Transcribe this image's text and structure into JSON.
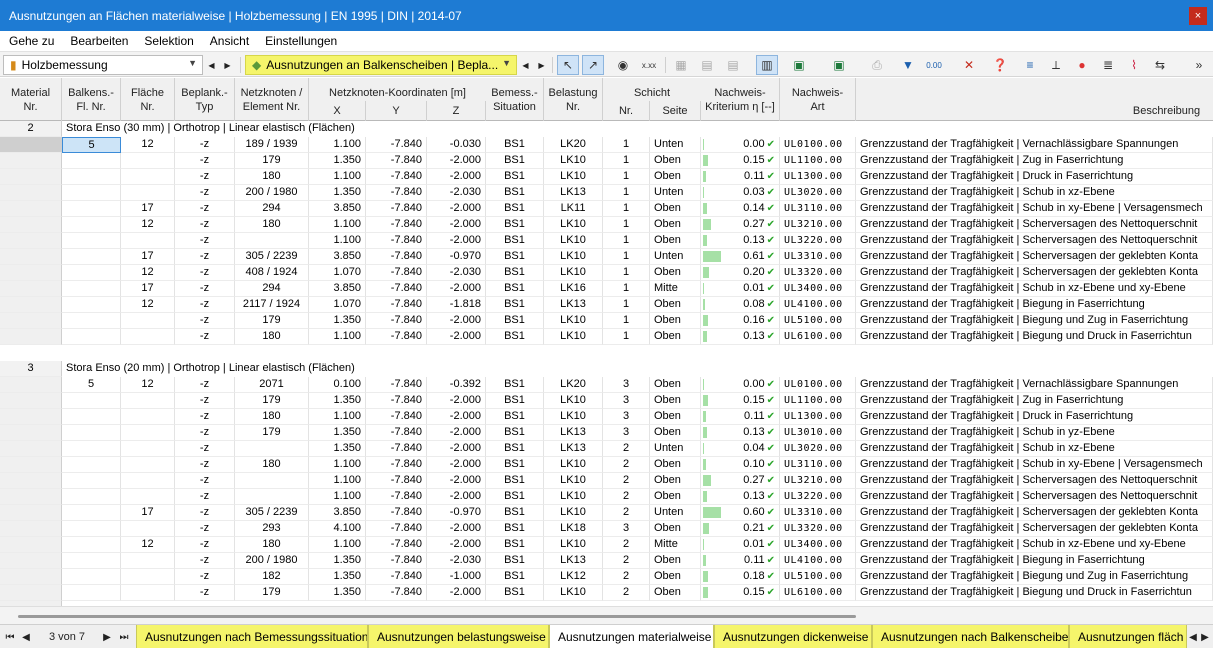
{
  "window": {
    "title": "Ausnutzungen an Flächen materialweise | Holzbemessung | EN 1995 | DIN | 2014-07",
    "close_glyph": "×"
  },
  "menu": [
    "Gehe zu",
    "Bearbeiten",
    "Selektion",
    "Ansicht",
    "Einstellungen"
  ],
  "toolbar": {
    "module_combo": "Holzbemessung",
    "result_combo": "Ausnutzungen an Balkenscheiben | Bepla..."
  },
  "columns": {
    "material": "Material\nNr.",
    "balken": "Balkens.-\nFl. Nr.",
    "flaeche": "Fläche\nNr.",
    "beplank": "Beplank.-\nTyp",
    "netz": "Netzknoten /\nElement Nr.",
    "koord_group": "Netzknoten-Koordinaten [m]",
    "x": "X",
    "y": "Y",
    "z": "Z",
    "bemess": "Bemess.-\nSituation",
    "belastung": "Belastung\nNr.",
    "schicht_group": "Schicht",
    "schicht_nr": "Nr.",
    "seite": "Seite",
    "kriterium": "Nachweis-\nKriterium η [--]",
    "art": "Nachweis-\nArt",
    "beschreibung": "Beschreibung"
  },
  "groups": [
    {
      "material": "2",
      "title": "Stora Enso (30 mm) | Orthotrop | Linear elastisch (Flächen)",
      "rows": [
        [
          "5",
          "12",
          "-z",
          "189 / 1939",
          "1.100",
          "-7.840",
          "-0.030",
          "BS1",
          "LK20",
          "1",
          "Unten",
          "0.00",
          "UL0100.00",
          "Grenzzustand der Tragfähigkeit | Vernachlässigbare Spannungen"
        ],
        [
          "",
          "",
          "-z",
          "179",
          "1.350",
          "-7.840",
          "-2.000",
          "BS1",
          "LK10",
          "1",
          "Oben",
          "0.15",
          "UL1100.00",
          "Grenzzustand der Tragfähigkeit | Zug in Faserrichtung"
        ],
        [
          "",
          "",
          "-z",
          "180",
          "1.100",
          "-7.840",
          "-2.000",
          "BS1",
          "LK10",
          "1",
          "Oben",
          "0.11",
          "UL1300.00",
          "Grenzzustand der Tragfähigkeit | Druck in Faserrichtung"
        ],
        [
          "",
          "",
          "-z",
          "200 / 1980",
          "1.350",
          "-7.840",
          "-2.030",
          "BS1",
          "LK13",
          "1",
          "Unten",
          "0.03",
          "UL3020.00",
          "Grenzzustand der Tragfähigkeit | Schub in xz-Ebene"
        ],
        [
          "",
          "17",
          "-z",
          "294",
          "3.850",
          "-7.840",
          "-2.000",
          "BS1",
          "LK11",
          "1",
          "Oben",
          "0.14",
          "UL3110.00",
          "Grenzzustand der Tragfähigkeit | Schub in xy-Ebene | Versagensmech"
        ],
        [
          "",
          "12",
          "-z",
          "180",
          "1.100",
          "-7.840",
          "-2.000",
          "BS1",
          "LK10",
          "1",
          "Oben",
          "0.27",
          "UL3210.00",
          "Grenzzustand der Tragfähigkeit | Scherversagen des Nettoquerschnit"
        ],
        [
          "",
          "",
          "-z",
          "",
          "1.100",
          "-7.840",
          "-2.000",
          "BS1",
          "LK10",
          "1",
          "Oben",
          "0.13",
          "UL3220.00",
          "Grenzzustand der Tragfähigkeit | Scherversagen des Nettoquerschnit"
        ],
        [
          "",
          "17",
          "-z",
          "305 / 2239",
          "3.850",
          "-7.840",
          "-0.970",
          "BS1",
          "LK10",
          "1",
          "Unten",
          "0.61",
          "UL3310.00",
          "Grenzzustand der Tragfähigkeit | Scherversagen der geklebten Konta"
        ],
        [
          "",
          "12",
          "-z",
          "408 / 1924",
          "1.070",
          "-7.840",
          "-2.030",
          "BS1",
          "LK10",
          "1",
          "Oben",
          "0.20",
          "UL3320.00",
          "Grenzzustand der Tragfähigkeit | Scherversagen der geklebten Konta"
        ],
        [
          "",
          "17",
          "-z",
          "294",
          "3.850",
          "-7.840",
          "-2.000",
          "BS1",
          "LK16",
          "1",
          "Mitte",
          "0.01",
          "UL3400.00",
          "Grenzzustand der Tragfähigkeit | Schub in xz-Ebene und xy-Ebene"
        ],
        [
          "",
          "12",
          "-z",
          "2117 / 1924",
          "1.070",
          "-7.840",
          "-1.818",
          "BS1",
          "LK13",
          "1",
          "Oben",
          "0.08",
          "UL4100.00",
          "Grenzzustand der Tragfähigkeit | Biegung in Faserrichtung"
        ],
        [
          "",
          "",
          "-z",
          "179",
          "1.350",
          "-7.840",
          "-2.000",
          "BS1",
          "LK10",
          "1",
          "Oben",
          "0.16",
          "UL5100.00",
          "Grenzzustand der Tragfähigkeit | Biegung und Zug in Faserrichtung"
        ],
        [
          "",
          "",
          "-z",
          "180",
          "1.100",
          "-7.840",
          "-2.000",
          "BS1",
          "LK10",
          "1",
          "Oben",
          "0.13",
          "UL6100.00",
          "Grenzzustand der Tragfähigkeit | Biegung und Druck in Faserrichtun"
        ]
      ]
    },
    {
      "material": "3",
      "title": "Stora Enso (20 mm) | Orthotrop | Linear elastisch (Flächen)",
      "rows": [
        [
          "5",
          "12",
          "-z",
          "2071",
          "0.100",
          "-7.840",
          "-0.392",
          "BS1",
          "LK20",
          "3",
          "Oben",
          "0.00",
          "UL0100.00",
          "Grenzzustand der Tragfähigkeit | Vernachlässigbare Spannungen"
        ],
        [
          "",
          "",
          "-z",
          "179",
          "1.350",
          "-7.840",
          "-2.000",
          "BS1",
          "LK10",
          "3",
          "Oben",
          "0.15",
          "UL1100.00",
          "Grenzzustand der Tragfähigkeit | Zug in Faserrichtung"
        ],
        [
          "",
          "",
          "-z",
          "180",
          "1.100",
          "-7.840",
          "-2.000",
          "BS1",
          "LK10",
          "3",
          "Oben",
          "0.11",
          "UL1300.00",
          "Grenzzustand der Tragfähigkeit | Druck in Faserrichtung"
        ],
        [
          "",
          "",
          "-z",
          "179",
          "1.350",
          "-7.840",
          "-2.000",
          "BS1",
          "LK13",
          "3",
          "Oben",
          "0.13",
          "UL3010.00",
          "Grenzzustand der Tragfähigkeit | Schub in yz-Ebene"
        ],
        [
          "",
          "",
          "-z",
          "",
          "1.350",
          "-7.840",
          "-2.000",
          "BS1",
          "LK13",
          "2",
          "Unten",
          "0.04",
          "UL3020.00",
          "Grenzzustand der Tragfähigkeit | Schub in xz-Ebene"
        ],
        [
          "",
          "",
          "-z",
          "180",
          "1.100",
          "-7.840",
          "-2.000",
          "BS1",
          "LK10",
          "2",
          "Oben",
          "0.10",
          "UL3110.00",
          "Grenzzustand der Tragfähigkeit | Schub in xy-Ebene | Versagensmech"
        ],
        [
          "",
          "",
          "-z",
          "",
          "1.100",
          "-7.840",
          "-2.000",
          "BS1",
          "LK10",
          "2",
          "Oben",
          "0.27",
          "UL3210.00",
          "Grenzzustand der Tragfähigkeit | Scherversagen des Nettoquerschnit"
        ],
        [
          "",
          "",
          "-z",
          "",
          "1.100",
          "-7.840",
          "-2.000",
          "BS1",
          "LK10",
          "2",
          "Oben",
          "0.13",
          "UL3220.00",
          "Grenzzustand der Tragfähigkeit | Scherversagen des Nettoquerschnit"
        ],
        [
          "",
          "17",
          "-z",
          "305 / 2239",
          "3.850",
          "-7.840",
          "-0.970",
          "BS1",
          "LK10",
          "2",
          "Unten",
          "0.60",
          "UL3310.00",
          "Grenzzustand der Tragfähigkeit | Scherversagen der geklebten Konta"
        ],
        [
          "",
          "",
          "-z",
          "293",
          "4.100",
          "-7.840",
          "-2.000",
          "BS1",
          "LK18",
          "3",
          "Oben",
          "0.21",
          "UL3320.00",
          "Grenzzustand der Tragfähigkeit | Scherversagen der geklebten Konta"
        ],
        [
          "",
          "12",
          "-z",
          "180",
          "1.100",
          "-7.840",
          "-2.000",
          "BS1",
          "LK10",
          "2",
          "Mitte",
          "0.01",
          "UL3400.00",
          "Grenzzustand der Tragfähigkeit | Schub in xz-Ebene und xy-Ebene"
        ],
        [
          "",
          "",
          "-z",
          "200 / 1980",
          "1.350",
          "-7.840",
          "-2.030",
          "BS1",
          "LK13",
          "2",
          "Oben",
          "0.11",
          "UL4100.00",
          "Grenzzustand der Tragfähigkeit | Biegung in Faserrichtung"
        ],
        [
          "",
          "",
          "-z",
          "182",
          "1.350",
          "-7.840",
          "-1.000",
          "BS1",
          "LK12",
          "2",
          "Oben",
          "0.18",
          "UL5100.00",
          "Grenzzustand der Tragfähigkeit | Biegung und Zug in Faserrichtung"
        ],
        [
          "",
          "",
          "-z",
          "179",
          "1.350",
          "-7.840",
          "-2.000",
          "BS1",
          "LK10",
          "2",
          "Oben",
          "0.15",
          "UL6100.00",
          "Grenzzustand der Tragfähigkeit | Biegung und Druck in Faserrichtun"
        ]
      ]
    }
  ],
  "pager": "3 von 7",
  "tabs": [
    {
      "label": "Ausnutzungen nach Bemessungssituation",
      "active": false
    },
    {
      "label": "Ausnutzungen belastungsweise",
      "active": false
    },
    {
      "label": "Ausnutzungen materialweise",
      "active": true
    },
    {
      "label": "Ausnutzungen dickenweise",
      "active": false
    },
    {
      "label": "Ausnutzungen nach Balkenscheibe",
      "active": false
    },
    {
      "label": "Ausnutzungen fläch",
      "active": false
    }
  ],
  "colors": {
    "accent": "#1e7bd3",
    "tab_yellow": "#f5f56b",
    "bar_green": "#a6e0a6",
    "check_green": "#2aa52a"
  }
}
